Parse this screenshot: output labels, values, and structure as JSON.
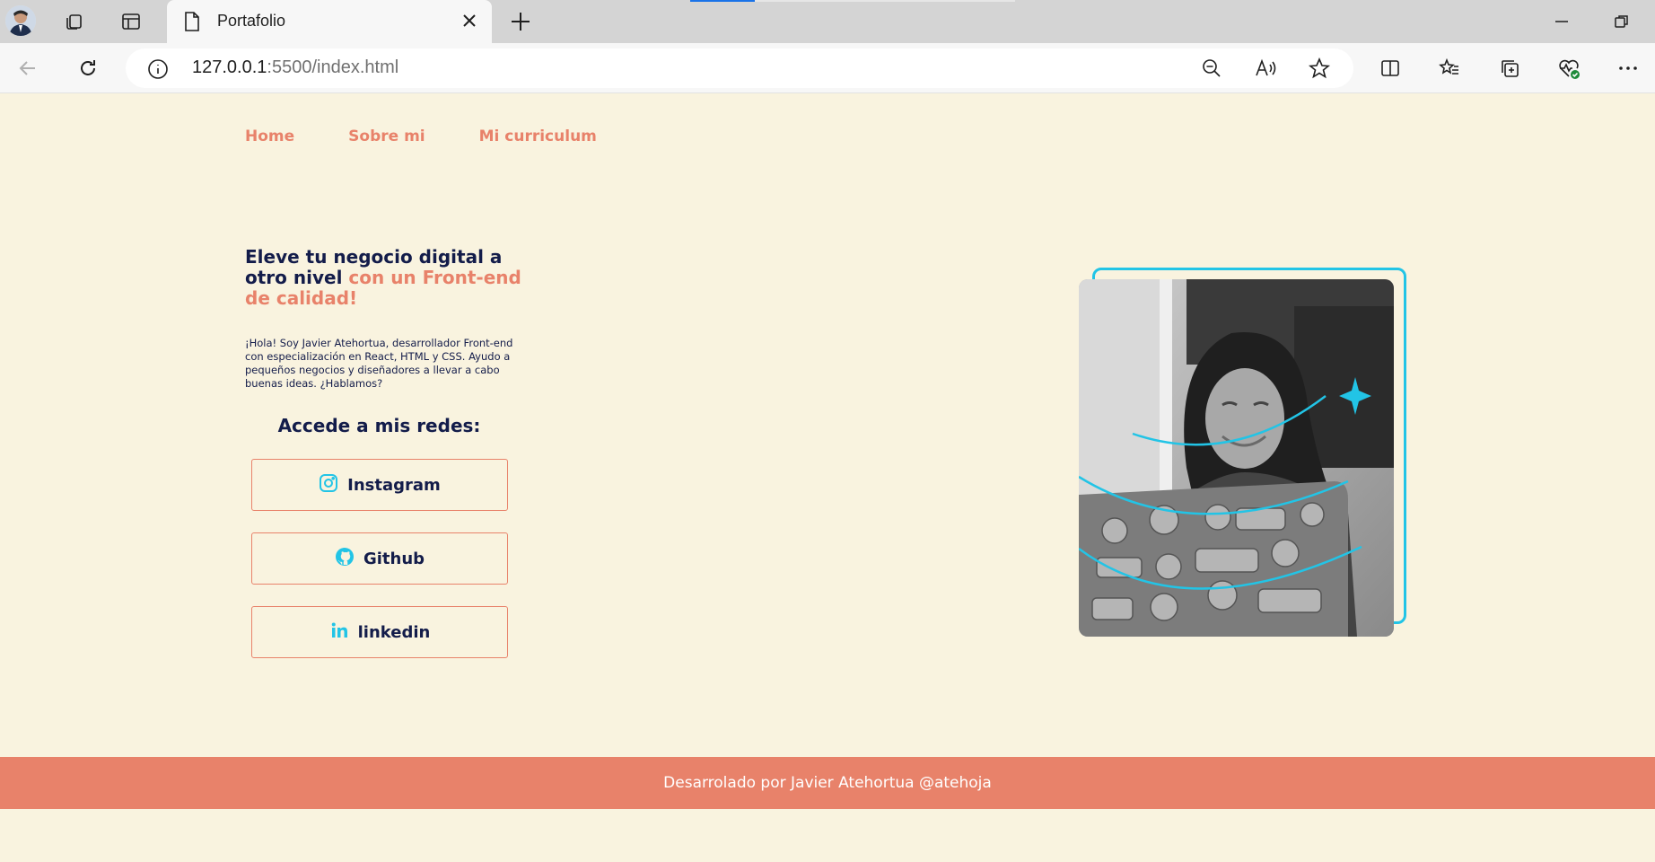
{
  "browser": {
    "tab_title": "Portafolio",
    "url_host": "127.0.0.1",
    "url_rest": ":5500/index.html",
    "icons": [
      "profile-avatar",
      "workspaces-icon",
      "vertical-tabs-icon",
      "page-icon",
      "close-icon",
      "new-tab-icon",
      "back-icon",
      "refresh-icon",
      "info-icon",
      "zoom-out-icon",
      "read-aloud-icon",
      "favorite-icon",
      "split-screen-icon",
      "favorites-icon",
      "collections-icon",
      "browser-essentials-icon",
      "more-icon",
      "minimize-icon",
      "restore-icon"
    ]
  },
  "nav": {
    "items": [
      "Home",
      "Sobre mi",
      "Mi curriculum"
    ]
  },
  "hero": {
    "headline_main": "Eleve tu negocio digital a otro nivel ",
    "headline_accent": "con un Front-end de calidad!",
    "intro": "¡Hola! Soy Javier Atehortua, desarrollador Front-end con especialización en React, HTML y CSS. Ayudo a pequeños negocios y diseñadores a llevar a cabo buenas ideas. ¿Hablamos?",
    "social_title": "Accede a mis redes:",
    "buttons": [
      {
        "label": "Instagram",
        "icon": "instagram-icon"
      },
      {
        "label": "Github",
        "icon": "github-icon"
      },
      {
        "label": "linkedin",
        "icon": "linkedin-icon"
      }
    ]
  },
  "colors": {
    "background": "#f9f3df",
    "accent": "#e8826a",
    "text": "#131c4a",
    "highlight": "#22c4e6"
  },
  "footer": {
    "text": "Desarrolado por Javier Atehortua @atehoja"
  }
}
